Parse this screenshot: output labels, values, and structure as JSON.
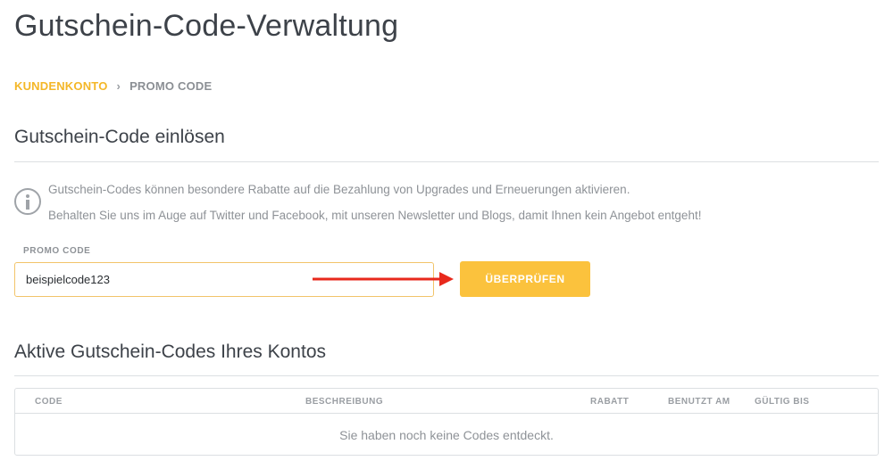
{
  "page": {
    "title": "Gutschein-Code-Verwaltung"
  },
  "breadcrumb": {
    "items": [
      "KUNDENKONTO",
      "PROMO CODE"
    ],
    "separator": "›"
  },
  "redeem": {
    "heading": "Gutschein-Code einlösen",
    "info_icon": "info-circle-icon",
    "info_lines": [
      "Gutschein-Codes können besondere Rabatte auf die Bezahlung von Upgrades und Erneuerungen aktivieren.",
      "Behalten Sie uns im Auge auf Twitter und Facebook, mit unseren Newsletter und Blogs, damit Ihnen kein Angebot entgeht!"
    ],
    "field_label": "PROMO CODE",
    "input_value": "beispielcode123",
    "button_label": "ÜBERPRÜFEN"
  },
  "active": {
    "heading": "Aktive Gutschein-Codes Ihres Kontos",
    "columns": [
      "CODE",
      "BESCHREIBUNG",
      "RABATT",
      "BENUTZT AM",
      "GÜLTIG BIS"
    ],
    "empty_message": "Sie haben noch keine Codes entdeckt."
  },
  "colors": {
    "accent": "#f4b728",
    "button": "#fbc23d",
    "annotation_arrow": "#e8291c"
  }
}
